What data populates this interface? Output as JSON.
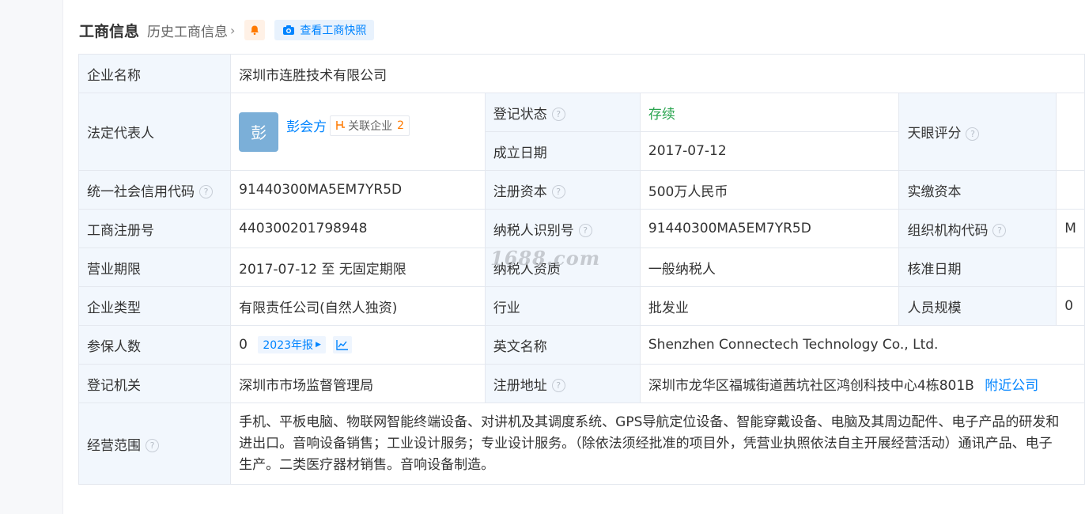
{
  "header": {
    "title": "工商信息",
    "history_label": "历史工商信息",
    "snapshot_label": "查看工商快照"
  },
  "colors": {
    "accent": "#0084ff",
    "label_bg": "#f2f7fd",
    "status_green": "#2aa44f",
    "count_orange": "#ff7a00"
  },
  "fields": {
    "company_name_label": "企业名称",
    "company_name": "深圳市连胜技术有限公司",
    "legal_rep_label": "法定代表人",
    "legal_rep_avatar": "彭",
    "legal_rep_name": "彭会方",
    "related_label": "关联企业",
    "related_count": "2",
    "reg_status_label": "登记状态",
    "reg_status": "存续",
    "found_date_label": "成立日期",
    "found_date": "2017-07-12",
    "tianyan_label": "天眼评分",
    "credit_code_label": "统一社会信用代码",
    "credit_code": "91440300MA5EM7YR5D",
    "reg_capital_label": "注册资本",
    "reg_capital": "500万人民币",
    "paid_capital_label": "实缴资本",
    "paid_capital": "",
    "reg_no_label": "工商注册号",
    "reg_no": "440300201798948",
    "taxpayer_id_label": "纳税人识别号",
    "taxpayer_id": "91440300MA5EM7YR5D",
    "org_code_label": "组织机构代码",
    "org_code": "M",
    "term_label": "营业期限",
    "term": "2017-07-12 至 无固定期限",
    "taxpayer_qual_label": "纳税人资质",
    "taxpayer_qual": "一般纳税人",
    "approve_date_label": "核准日期",
    "type_label": "企业类型",
    "type": "有限责任公司(自然人独资)",
    "industry_label": "行业",
    "industry": "批发业",
    "staff_scale_label": "人员规模",
    "staff_scale": "0",
    "insured_label": "参保人数",
    "insured": "0",
    "insured_year": "2023年报",
    "english_name_label": "英文名称",
    "english_name": "Shenzhen Connectech Technology Co., Ltd.",
    "authority_label": "登记机关",
    "authority": "深圳市市场监督管理局",
    "address_label": "注册地址",
    "address": "深圳市龙华区福城街道茜坑社区鸿创科技中心4栋801B",
    "nearby_label": "附近公司",
    "scope_label": "经营范围",
    "scope_line1": "手机、平板电脑、物联网智能终端设备、对讲机及其调度系统、GPS导航定位设备、智能穿戴设备、电脑及其周边配件、电子产品的研发和",
    "scope_line2": "进出口。音响设备销售；工业设计服务；专业设计服务。（除依法须经批准的项目外，凭营业执照依法自主开展经营活动）通讯产品、电子",
    "scope_line3": "生产。二类医疗器材销售。音响设备制造。"
  },
  "watermark": "1688.com"
}
